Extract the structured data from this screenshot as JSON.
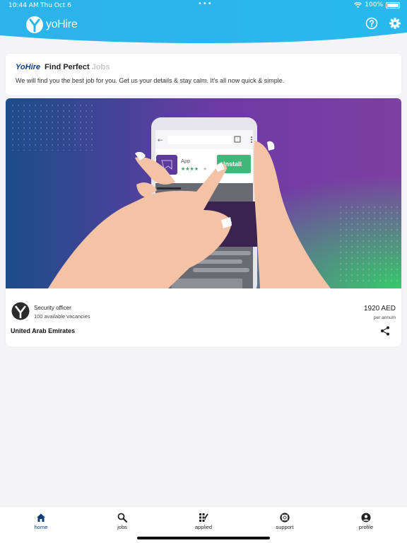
{
  "status_bar": {
    "time": "10:44 AM",
    "date": "Thu Oct 6",
    "battery": "100%",
    "battery_level": 1.0
  },
  "header": {
    "app_name": "yoHire",
    "help_icon": "help-circle-icon",
    "settings_icon": "gear-icon",
    "color": "#2ab6ea"
  },
  "intro": {
    "brand": "YoHire",
    "title": "Find Perfect",
    "title_faded": "Jobs",
    "description": "We will find you the best job for you. Get us your details & stay calm. It's all now quick & simple."
  },
  "banner": {
    "app_label": "App",
    "install_label": "Install",
    "rating_stars": 4,
    "gradient": [
      "#1a4f8c",
      "#7a3aa5",
      "#3cc46f"
    ]
  },
  "job": {
    "title": "Security officer",
    "vacancies": "100 available vacancies",
    "salary": "1920 AED",
    "period": "per annum",
    "country": "United Arab Emirates",
    "share_icon": "share-icon"
  },
  "nav": {
    "items": [
      {
        "label": "home",
        "icon": "home-icon",
        "active": true
      },
      {
        "label": "jobs",
        "icon": "search-icon",
        "active": false
      },
      {
        "label": "applied",
        "icon": "applied-icon",
        "active": false
      },
      {
        "label": "support",
        "icon": "lifebuoy-icon",
        "active": false
      },
      {
        "label": "profile",
        "icon": "profile-icon",
        "active": false
      }
    ],
    "active_color": "#0d3b7a"
  }
}
